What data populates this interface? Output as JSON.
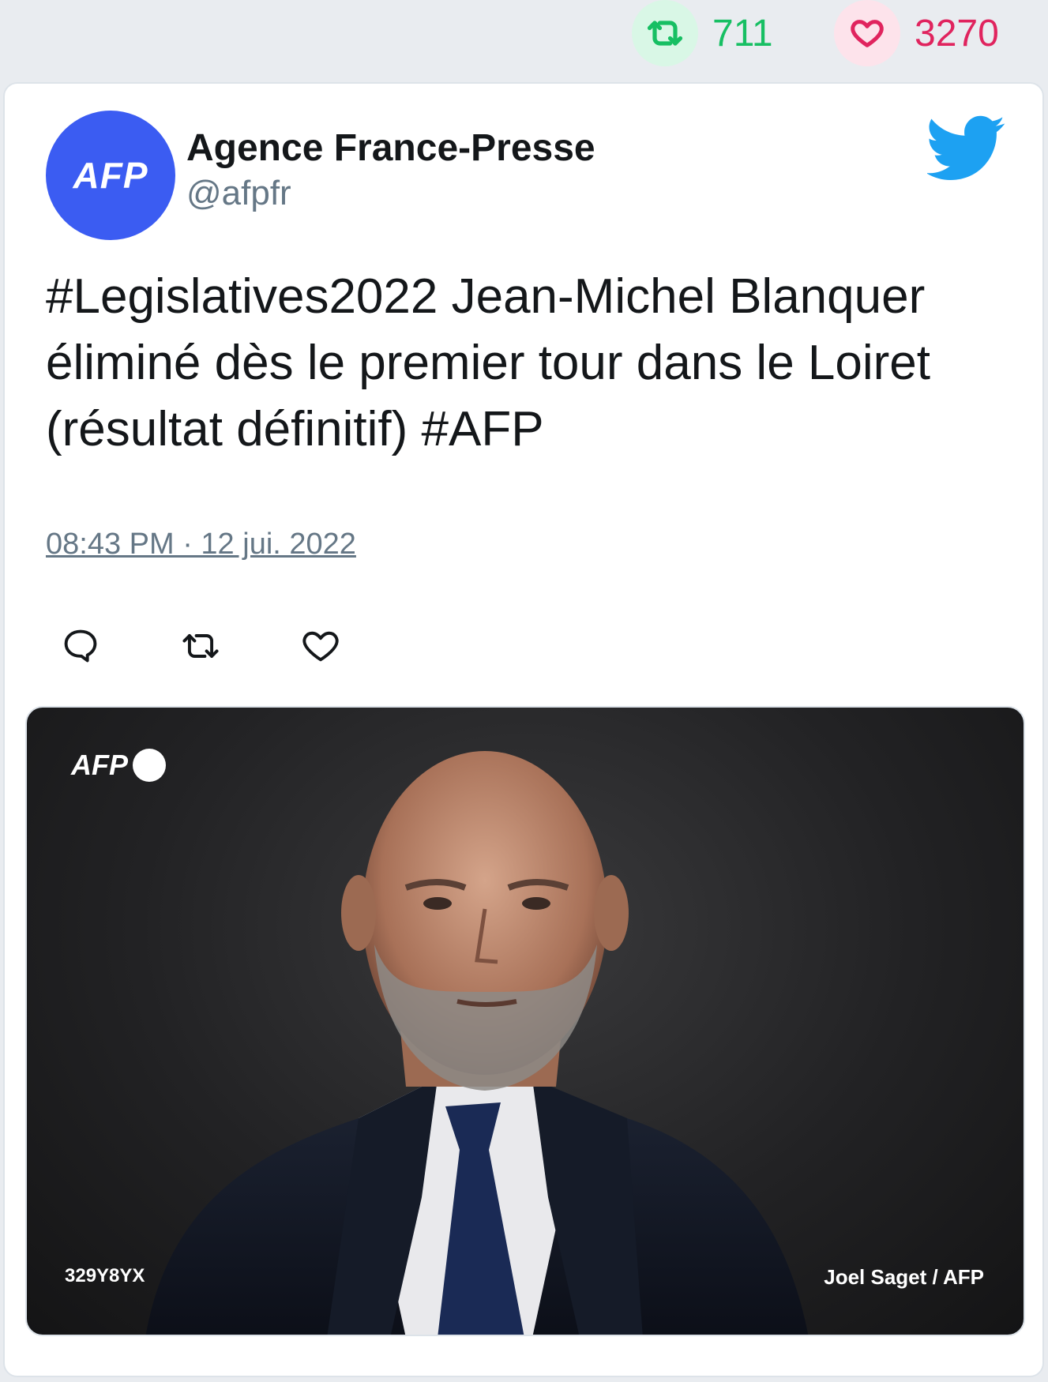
{
  "stats": {
    "retweets": "711",
    "likes": "3270",
    "retweet_icon": "retweet-icon",
    "like_icon": "heart-icon",
    "retweet_color": "#17bf63",
    "like_color": "#e0245e"
  },
  "tweet": {
    "author_name": "Agence France-Presse",
    "handle": "@afpfr",
    "avatar_text": "AFP",
    "avatar_color": "#3b5cf2",
    "text": "#Legislatives2022 Jean-Michel Blanquer éliminé dès le premier tour dans le Loiret (résultat définitif) #AFP",
    "timestamp": "08:43 PM · 12 jui. 2022",
    "brand_icon": "twitter-bird-icon",
    "brand_color": "#1da1f2",
    "actions": [
      "reply-icon",
      "retweet-icon",
      "heart-icon"
    ]
  },
  "media": {
    "watermark_logo": "AFP",
    "photo_id": "329Y8YX",
    "credit": "Joel Saget / AFP"
  }
}
